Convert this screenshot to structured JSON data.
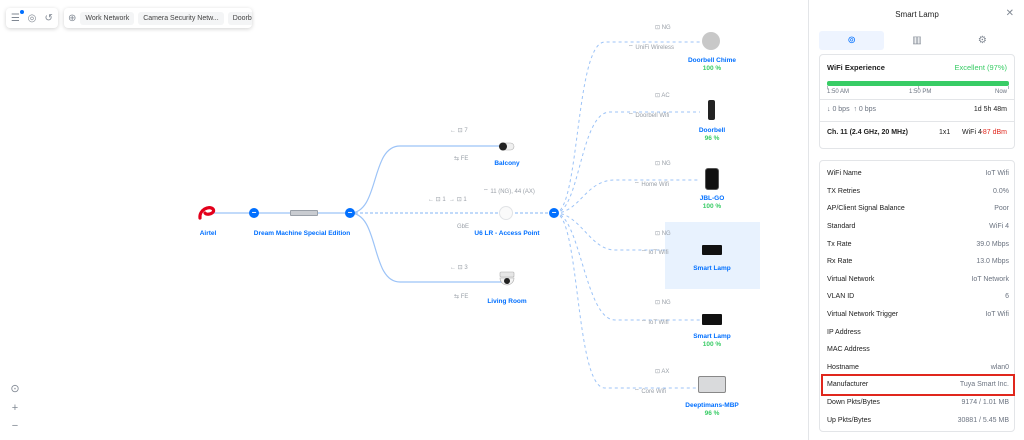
{
  "toolbar": {
    "chips": [
      "Work Network",
      "Camera Security Netw...",
      "Doorbell"
    ]
  },
  "topology": {
    "gateway": {
      "name": "Airtel"
    },
    "router": {
      "name": "Dream Machine Special Edition"
    },
    "ap": {
      "name": "U6 LR - Access Point",
      "meta_up": "1",
      "meta_down": "1",
      "radio": "11 (NG), 44 (AX)",
      "link": "GbE"
    },
    "cameras": [
      {
        "name": "Balcony",
        "count": "7",
        "link": "FE"
      },
      {
        "name": "Living Room",
        "count": "3",
        "link": "FE"
      }
    ],
    "clients": [
      {
        "name": "Doorbell Chime",
        "pct": "100 %",
        "band": "NG",
        "ssid": "UniFi Wireless"
      },
      {
        "name": "Doorbell",
        "pct": "96 %",
        "band": "AC",
        "ssid": "Doorbell Wifi"
      },
      {
        "name": "JBL-GO",
        "pct": "100 %",
        "band": "NG",
        "ssid": "Home Wifi"
      },
      {
        "name": "Smart Lamp",
        "pct": "",
        "band": "NG",
        "ssid": "IoT Wifi"
      },
      {
        "name": "Smart Lamp",
        "pct": "100 %",
        "band": "NG",
        "ssid": "IoT Wifi"
      },
      {
        "name": "Deeptimans-MBP",
        "pct": "96 %",
        "band": "AX",
        "ssid": "Core Wifi"
      }
    ]
  },
  "panel": {
    "title": "Smart Lamp",
    "wifi_experience_label": "WiFi Experience",
    "wifi_experience_value": "Excellent (97%)",
    "time_start": "1:50 AM",
    "time_mid": "1:50 PM",
    "time_end": "Now",
    "down_rate": "0 bps",
    "up_rate": "0 bps",
    "uptime": "1d 5h 48m",
    "channel": "Ch. 11 (2.4 GHz, 20 MHz)",
    "mimo": "1x1",
    "wifi_std": "WiFi 4",
    "signal": "-87 dBm",
    "colors": {
      "accent": "#006fff",
      "good": "#38cc65",
      "bad": "#e0271d"
    },
    "rows": [
      {
        "k": "WiFi Name",
        "v": "IoT Wifi"
      },
      {
        "k": "TX Retries",
        "v": "0.0%"
      },
      {
        "k": "AP/Client Signal Balance",
        "v": "Poor"
      },
      {
        "k": "Standard",
        "v": "WiFi 4"
      },
      {
        "k": "Tx Rate",
        "v": "39.0 Mbps"
      },
      {
        "k": "Rx Rate",
        "v": "13.0 Mbps"
      },
      {
        "k": "Virtual Network",
        "v": "IoT Network"
      },
      {
        "k": "VLAN ID",
        "v": "6"
      },
      {
        "k": "Virtual Network Trigger",
        "v": "IoT Wifi"
      },
      {
        "k": "IP Address",
        "v": ""
      },
      {
        "k": "MAC Address",
        "v": ""
      },
      {
        "k": "Hostname",
        "v": "wlan0"
      },
      {
        "k": "Manufacturer",
        "v": "Tuya Smart Inc."
      },
      {
        "k": "Down Pkts/Bytes",
        "v": "9174 / 1.01 MB"
      },
      {
        "k": "Up Pkts/Bytes",
        "v": "30881 / 5.45 MB"
      }
    ]
  }
}
